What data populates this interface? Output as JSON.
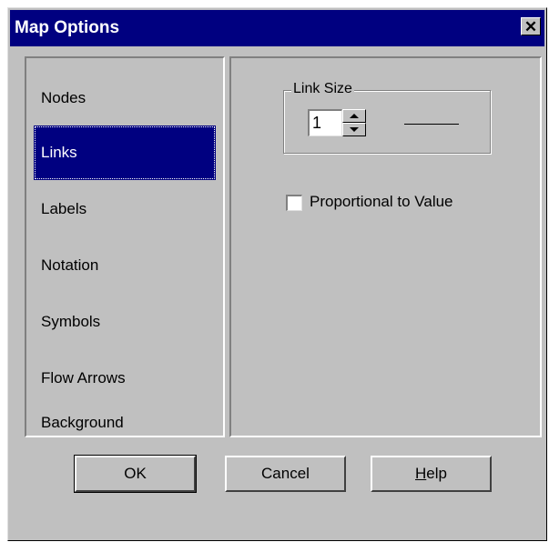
{
  "window": {
    "title": "Map Options",
    "close_glyph": "✕"
  },
  "nav": {
    "items": [
      {
        "label": "Nodes",
        "selected": false
      },
      {
        "label": "Links",
        "selected": true
      },
      {
        "label": "Labels",
        "selected": false
      },
      {
        "label": "Notation",
        "selected": false
      },
      {
        "label": "Symbols",
        "selected": false
      },
      {
        "label": "Flow Arrows",
        "selected": false
      },
      {
        "label": "Background",
        "selected": false
      }
    ]
  },
  "link_size": {
    "group_label": "Link Size",
    "value": "1"
  },
  "proportional": {
    "label": "Proportional to Value",
    "checked": false
  },
  "buttons": {
    "ok": "OK",
    "cancel": "Cancel",
    "help": "Help"
  },
  "colors": {
    "titlebar": "#000080",
    "face": "#c0c0c0",
    "selection": "#000080"
  }
}
